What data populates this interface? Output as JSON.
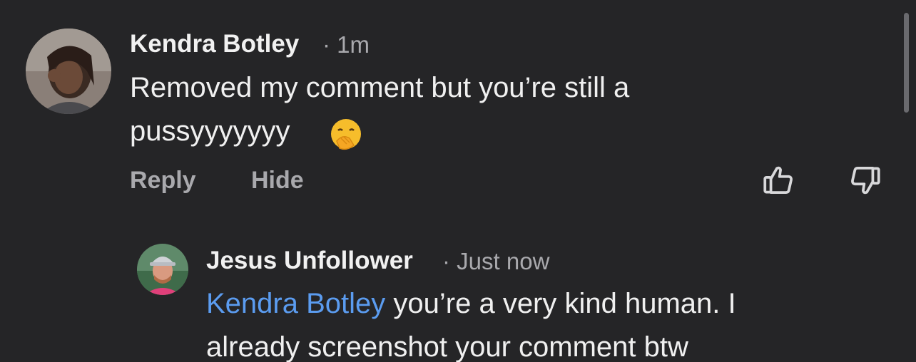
{
  "comment": {
    "author": "Kendra Botley",
    "separator": "·",
    "time": "1m",
    "text_line1": "Removed my comment but you’re still a",
    "text_line2": "pussyyyyyyy",
    "emoji": "face-with-hand-over-mouth",
    "actions": {
      "reply": "Reply",
      "hide": "Hide"
    }
  },
  "reply": {
    "author": "Jesus Unfollower",
    "separator": "·",
    "time": "Just now",
    "mention": "Kendra Botley",
    "text_line1_rest": " you’re a very kind human. I",
    "text_line2": "already screenshot your comment btw"
  },
  "colors": {
    "background": "#252527",
    "text": "#f0f0f0",
    "muted": "#a9a9ad",
    "mention": "#5b9cf0"
  }
}
